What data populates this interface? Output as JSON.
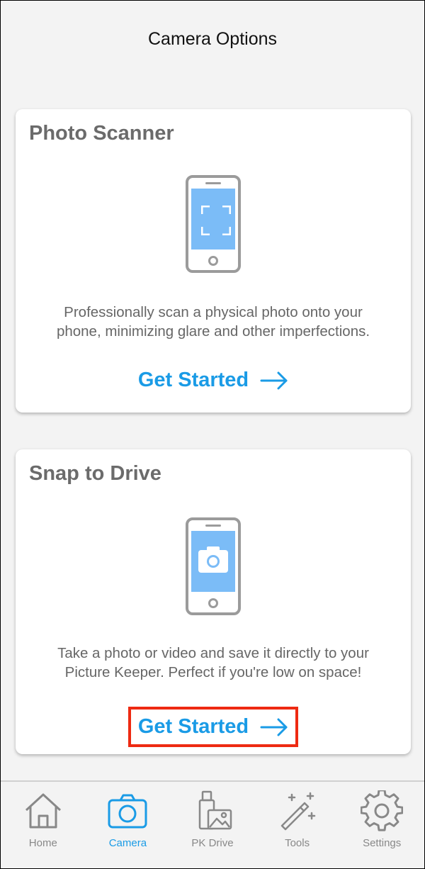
{
  "header": {
    "title": "Camera Options"
  },
  "cards": [
    {
      "title": "Photo Scanner",
      "description_line1": "Professionally scan a physical photo onto your",
      "description_line2": "phone, minimizing glare and other imperfections.",
      "cta_label": "Get Started",
      "icon": "phone-scan-icon"
    },
    {
      "title": "Snap to Drive",
      "description_line1": "Take a photo or video and save it directly to your",
      "description_line2": "Picture Keeper. Perfect if you're low on space!",
      "cta_label": "Get Started",
      "icon": "phone-camera-icon",
      "highlighted": true
    }
  ],
  "tabbar": {
    "items": [
      {
        "label": "Home",
        "icon": "home-icon"
      },
      {
        "label": "Camera",
        "icon": "camera-icon",
        "active": true
      },
      {
        "label": "PK Drive",
        "icon": "pk-drive-icon"
      },
      {
        "label": "Tools",
        "icon": "magic-wand-icon"
      },
      {
        "label": "Settings",
        "icon": "gear-icon"
      }
    ]
  },
  "colors": {
    "accent": "#1a9be6",
    "highlight_border": "#ee2a12",
    "phone_screen": "#7bbcf7",
    "card_title": "#6b6b6b"
  }
}
